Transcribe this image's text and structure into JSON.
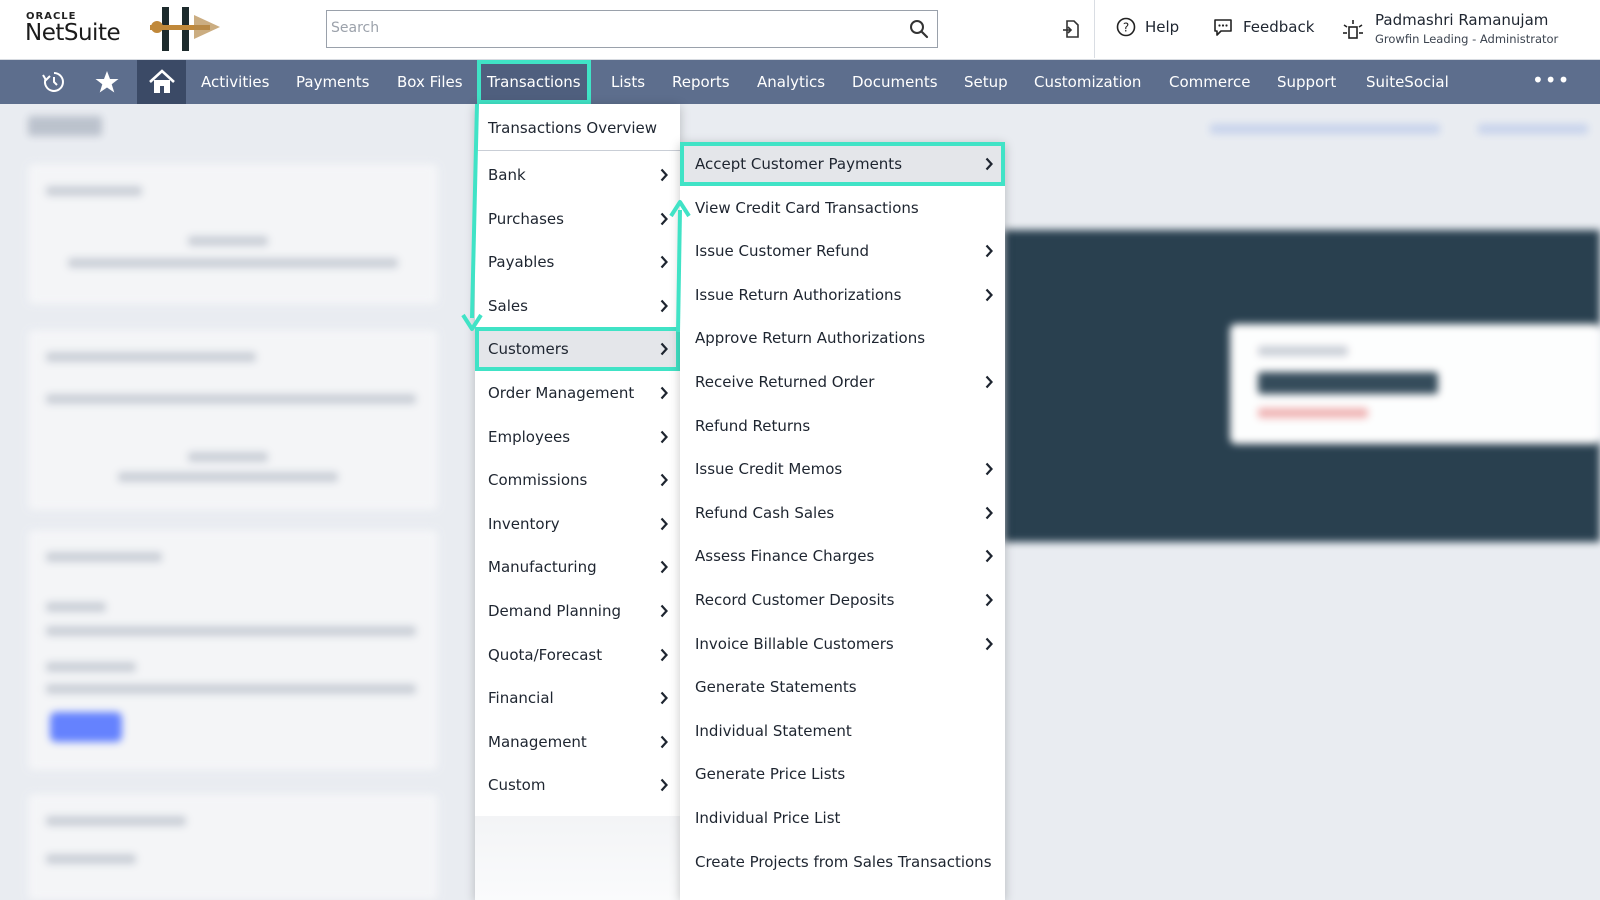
{
  "header": {
    "oracle_label": "ORACLE",
    "netsuite_label": "NetSuite",
    "search_placeholder": "Search",
    "help_label": "Help",
    "feedback_label": "Feedback",
    "user_name": "Padmashri Ramanujam",
    "user_role": "Growfin Leading - Administrator"
  },
  "nav": {
    "tabs": [
      "Activities",
      "Payments",
      "Box Files",
      "Transactions",
      "Lists",
      "Reports",
      "Analytics",
      "Documents",
      "Setup",
      "Customization",
      "Commerce",
      "Support",
      "SuiteSocial"
    ],
    "active_tab": "Transactions",
    "more_label": "•••"
  },
  "transactions_menu": {
    "overview": "Transactions Overview",
    "items": [
      "Bank",
      "Purchases",
      "Payables",
      "Sales",
      "Customers",
      "Order Management",
      "Employees",
      "Commissions",
      "Inventory",
      "Manufacturing",
      "Demand Planning",
      "Quota/Forecast",
      "Financial",
      "Management",
      "Custom"
    ],
    "highlighted": "Customers"
  },
  "customers_submenu": {
    "items": [
      {
        "label": "Accept Customer Payments",
        "has_submenu": true
      },
      {
        "label": "View Credit Card Transactions",
        "has_submenu": false
      },
      {
        "label": "Issue Customer Refund",
        "has_submenu": true
      },
      {
        "label": "Issue Return Authorizations",
        "has_submenu": true
      },
      {
        "label": "Approve Return Authorizations",
        "has_submenu": false
      },
      {
        "label": "Receive Returned Order",
        "has_submenu": true
      },
      {
        "label": "Refund Returns",
        "has_submenu": false
      },
      {
        "label": "Issue Credit Memos",
        "has_submenu": true
      },
      {
        "label": "Refund Cash Sales",
        "has_submenu": true
      },
      {
        "label": "Assess Finance Charges",
        "has_submenu": true
      },
      {
        "label": "Record Customer Deposits",
        "has_submenu": true
      },
      {
        "label": "Invoice Billable Customers",
        "has_submenu": true
      },
      {
        "label": "Generate Statements",
        "has_submenu": false
      },
      {
        "label": "Individual Statement",
        "has_submenu": false
      },
      {
        "label": "Generate Price Lists",
        "has_submenu": false
      },
      {
        "label": "Individual Price List",
        "has_submenu": false
      },
      {
        "label": "Create Projects from Sales Transactions",
        "has_submenu": false
      }
    ],
    "highlighted": "Accept Customer Payments"
  },
  "colors": {
    "nav_bg": "#5d6e8d",
    "nav_home_bg": "#3b4a66",
    "annotation_teal": "#40e3c6",
    "menu_highlight": "#e4e6ea"
  }
}
